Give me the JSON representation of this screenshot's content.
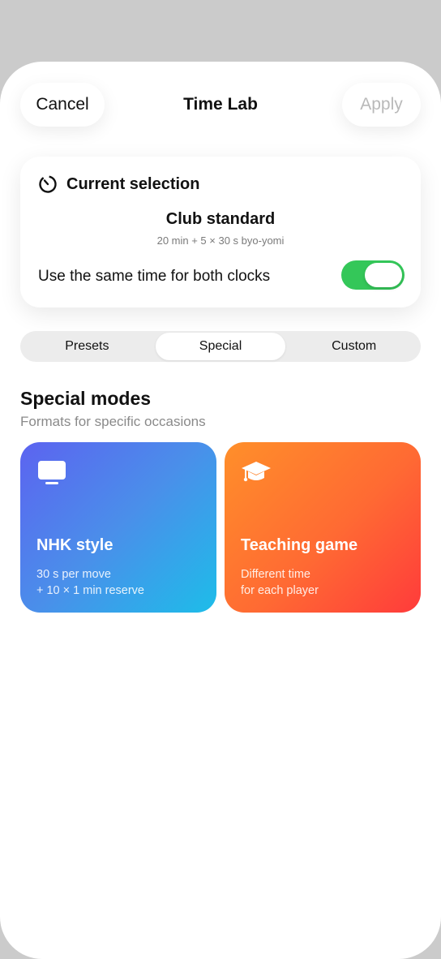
{
  "header": {
    "cancel_label": "Cancel",
    "title": "Time Lab",
    "apply_label": "Apply"
  },
  "current_selection": {
    "heading": "Current selection",
    "icon": "timer-icon",
    "name": "Club standard",
    "detail": "20 min + 5 × 30 s byo-yomi",
    "same_time_label": "Use the same time for both clocks",
    "same_time_enabled": true
  },
  "tabs": [
    {
      "label": "Presets",
      "active": false
    },
    {
      "label": "Special",
      "active": true
    },
    {
      "label": "Custom",
      "active": false
    }
  ],
  "special": {
    "title": "Special modes",
    "subtitle": "Formats for specific occasions",
    "modes": [
      {
        "icon": "tv-icon",
        "title": "NHK style",
        "line1": "30 s per move",
        "line2": "+ 10 × 1 min reserve"
      },
      {
        "icon": "graduation-cap-icon",
        "title": "Teaching game",
        "line1": "Different time",
        "line2": "for each player"
      }
    ]
  },
  "colors": {
    "toggle_on": "#34c759",
    "nhk_gradient": [
      "#5c63f0",
      "#1dbde9"
    ],
    "teach_gradient": [
      "#ff8f2a",
      "#ff3b3b"
    ]
  }
}
